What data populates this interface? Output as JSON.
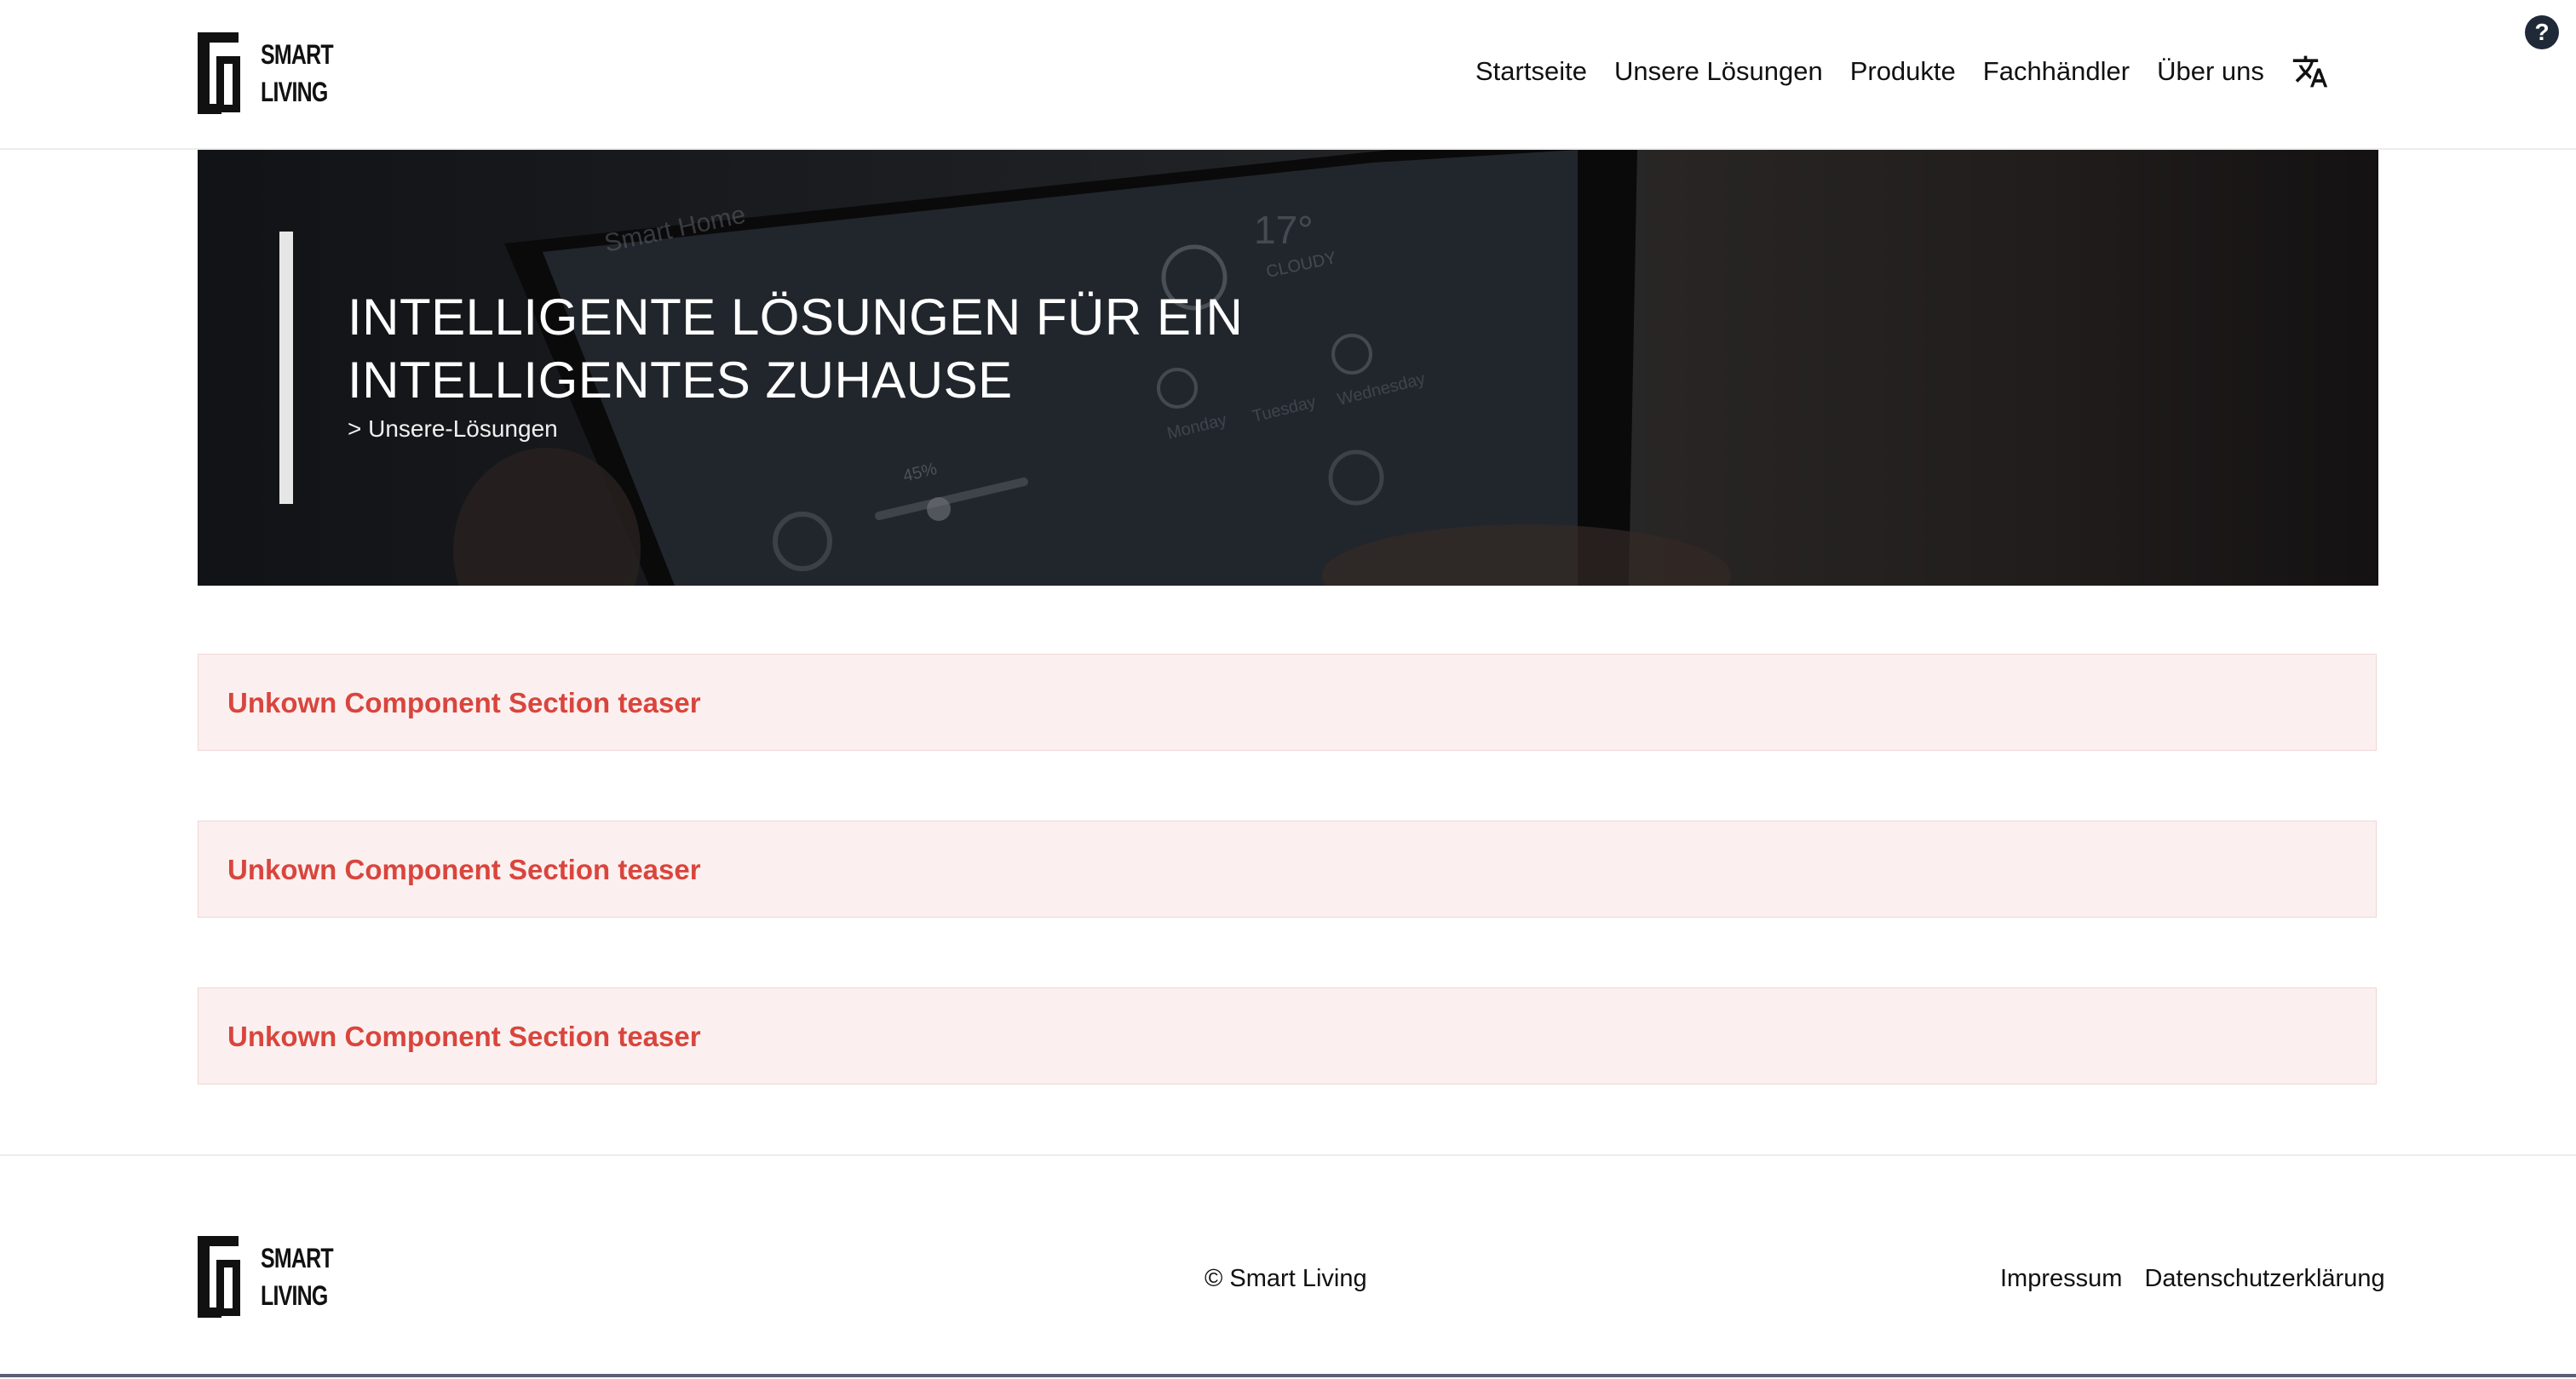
{
  "header": {
    "logo": {
      "line1": "SMART",
      "line2": "LIVING"
    },
    "nav": [
      {
        "label": "Startseite"
      },
      {
        "label": "Unsere Lösungen"
      },
      {
        "label": "Produkte"
      },
      {
        "label": "Fachhändler"
      },
      {
        "label": "Über uns"
      }
    ],
    "translate_icon": "translate-icon",
    "help_label": "?"
  },
  "hero": {
    "title": "INTELLIGENTE LÖSUNGEN FÜR EIN INTELLIGENTES ZUHAUSE",
    "breadcrumb": "> Unsere-Lösungen",
    "image_text": {
      "app": "Smart Home",
      "temp": "17°",
      "condition": "CLOUDY",
      "humidity": "45%",
      "days": [
        "Monday",
        "Tuesday",
        "Wednesday"
      ]
    }
  },
  "teasers": [
    {
      "label": "Unkown Component Section teaser"
    },
    {
      "label": "Unkown Component Section teaser"
    },
    {
      "label": "Unkown Component Section teaser"
    }
  ],
  "footer": {
    "logo": {
      "line1": "SMART",
      "line2": "LIVING"
    },
    "copyright": "© Smart Living",
    "links": [
      {
        "label": "Impressum"
      },
      {
        "label": "Datenschutzerklärung"
      }
    ]
  },
  "colors": {
    "teaser_text": "#d9453d",
    "teaser_bg": "#fbf0ef",
    "help_bg": "#1f2937"
  }
}
